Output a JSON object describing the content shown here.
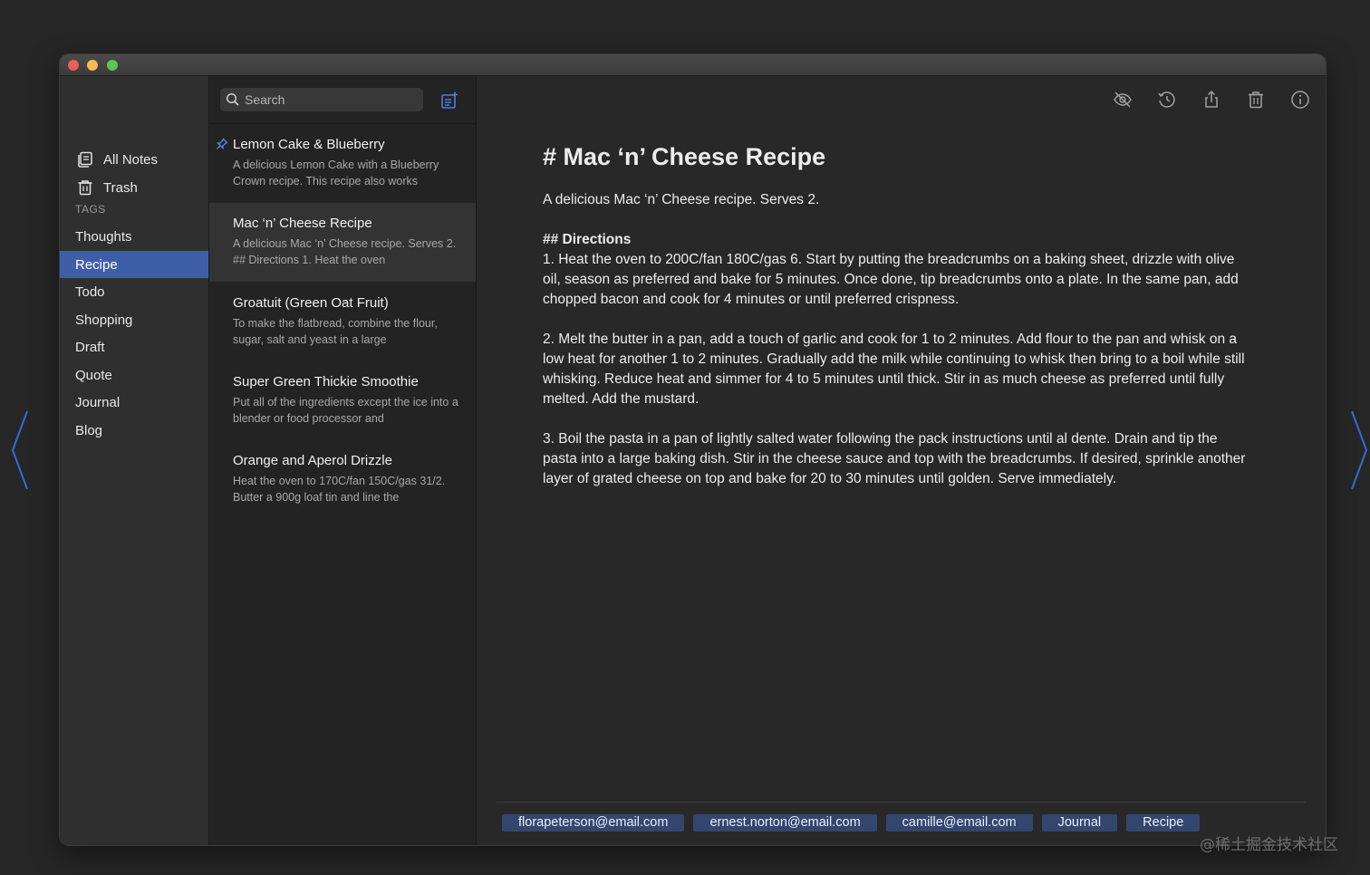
{
  "sidebar": {
    "all_notes": "All Notes",
    "trash": "Trash",
    "tags_heading": "TAGS",
    "tags": [
      "Thoughts",
      "Recipe",
      "Todo",
      "Shopping",
      "Draft",
      "Quote",
      "Journal",
      "Blog"
    ],
    "active_tag": "Recipe"
  },
  "list": {
    "search_placeholder": "Search",
    "notes": [
      {
        "title": "Lemon Cake & Blueberry",
        "preview": "A delicious Lemon Cake with a Blueberry Crown recipe. This recipe also works",
        "pinned": true
      },
      {
        "title": "Mac ‘n’ Cheese Recipe",
        "preview": "A delicious Mac ‘n’ Cheese recipe. Serves 2. ## Directions 1. Heat the oven",
        "selected": true
      },
      {
        "title": "Groatuit (Green Oat Fruit)",
        "preview": "To make the flatbread, combine the flour, sugar, salt and yeast in a large"
      },
      {
        "title": "Super Green Thickie Smoothie",
        "preview": "Put all of the ingredients except the ice into a blender or food processor and"
      },
      {
        "title": "Orange and Aperol Drizzle",
        "preview": "Heat the oven to 170C/fan 150C/gas 31/2. Butter a 900g loaf tin and line the"
      }
    ]
  },
  "editor": {
    "toolbar": [
      "eye-slash-icon",
      "history-icon",
      "share-icon",
      "trash-icon",
      "info-icon"
    ],
    "title": "# Mac ‘n’ Cheese Recipe",
    "intro": "A delicious Mac ‘n’ Cheese recipe. Serves 2.",
    "directions_heading": "## Directions",
    "step1": "1. Heat the oven to 200C/fan 180C/gas 6. Start by putting the breadcrumbs on a baking sheet, drizzle with olive oil, season as preferred and bake for 5 minutes. Once done, tip breadcrumbs onto a plate. In the same pan, add chopped bacon and cook for 4 minutes or until preferred crispness.",
    "step2": "2. Melt the butter in a pan, add a touch of garlic and cook for 1 to 2 minutes. Add flour to the pan and whisk on a low heat for another 1 to 2 minutes. Gradually add the milk while continuing to whisk then bring to a boil while still whisking. Reduce heat and simmer for 4 to 5 minutes until thick. Stir in as much cheese as preferred until fully melted. Add the mustard.",
    "step3": "3. Boil the pasta in a pan of lightly salted water following the pack instructions until al dente. Drain and tip the pasta into a large baking dish. Stir in the cheese sauce and top with the breadcrumbs. If desired, sprinkle another layer of grated cheese on top and bake for 20 to 30 minutes until golden. Serve immediately.",
    "chips": [
      "florapeterson@email.com",
      "ernest.norton@email.com",
      "camille@email.com",
      "Journal",
      "Recipe"
    ]
  },
  "watermark": "@稀土掘金技术社区",
  "colors": {
    "accent": "#3f5ea8",
    "chip_bg": "#33466e",
    "nav_arrow": "#2f6fd6"
  }
}
